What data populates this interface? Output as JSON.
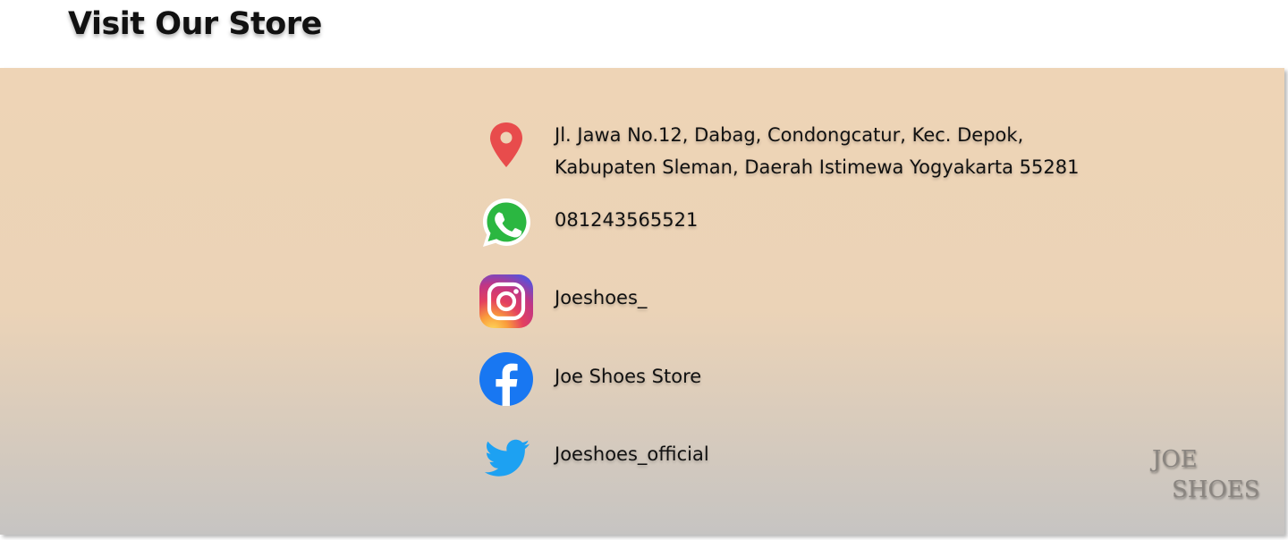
{
  "section": {
    "title": "Visit Our Store"
  },
  "contacts": {
    "address": {
      "icon": "location-pin-icon",
      "line1": "Jl. Jawa No.12, Dabag, Condongcatur,  Kec. Depok,",
      "line2": "Kabupaten Sleman, Daerah Istimewa Yogyakarta 55281"
    },
    "whatsapp": {
      "icon": "whatsapp-icon",
      "text": "081243565521"
    },
    "instagram": {
      "icon": "instagram-icon",
      "text": "Joeshoes_"
    },
    "facebook": {
      "icon": "facebook-icon",
      "text": "Joe Shoes Store"
    },
    "twitter": {
      "icon": "twitter-icon",
      "text": "Joeshoes_official"
    }
  },
  "brand": {
    "line1": "JOE",
    "line2": "SHOES"
  },
  "colors": {
    "pin": "#e84c4c",
    "whatsapp": "#2bb741",
    "facebook": "#1877f2",
    "twitter": "#1da1f2",
    "panel_top": "#eed4b6",
    "panel_bottom": "#c6c4c2"
  }
}
